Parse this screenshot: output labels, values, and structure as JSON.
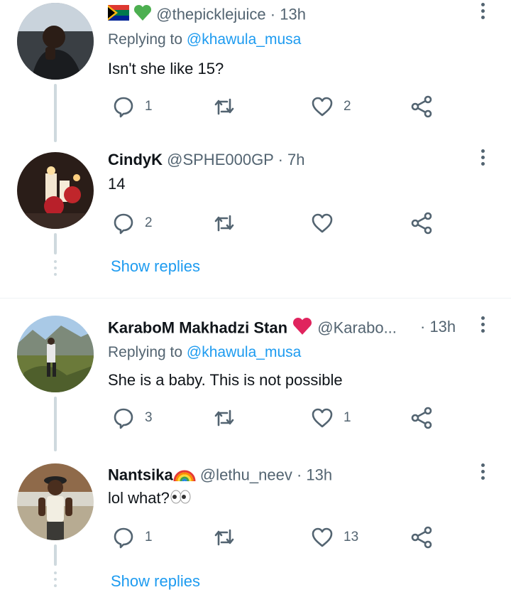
{
  "tweets": [
    {
      "name": "",
      "handle": "@thepicklejuice",
      "time": "· 13h",
      "replying_prefix": "Replying to",
      "replying_to": "@khawula_musa",
      "text": "Isn't she like 15?",
      "replies": "1",
      "retweets": "",
      "likes": "2"
    },
    {
      "name": "CindyK",
      "handle": "@SPHE000GP",
      "time": "· 7h",
      "text": "14",
      "replies": "2",
      "retweets": "",
      "likes": ""
    },
    {
      "name": "KaraboM Makhadzi Stan",
      "handle": "@Karabo...",
      "time": "· 13h",
      "replying_prefix": "Replying to",
      "replying_to": "@khawula_musa",
      "text": "She is a baby. This is not possible",
      "replies": "3",
      "retweets": "",
      "likes": "1"
    },
    {
      "name": "Nantsika",
      "handle": "@lethu_neev",
      "time": "· 13h",
      "text": "lol what?",
      "replies": "1",
      "retweets": "",
      "likes": "13"
    }
  ],
  "show_replies_label": "Show replies",
  "colors": {
    "link": "#1d9bf0",
    "secondary": "#536471",
    "primary": "#0f1419",
    "thread": "#cfd9de",
    "heart_emoji": "#e0245e"
  },
  "icons": [
    "reply-icon",
    "retweet-icon",
    "like-icon",
    "share-icon",
    "more-icon"
  ]
}
